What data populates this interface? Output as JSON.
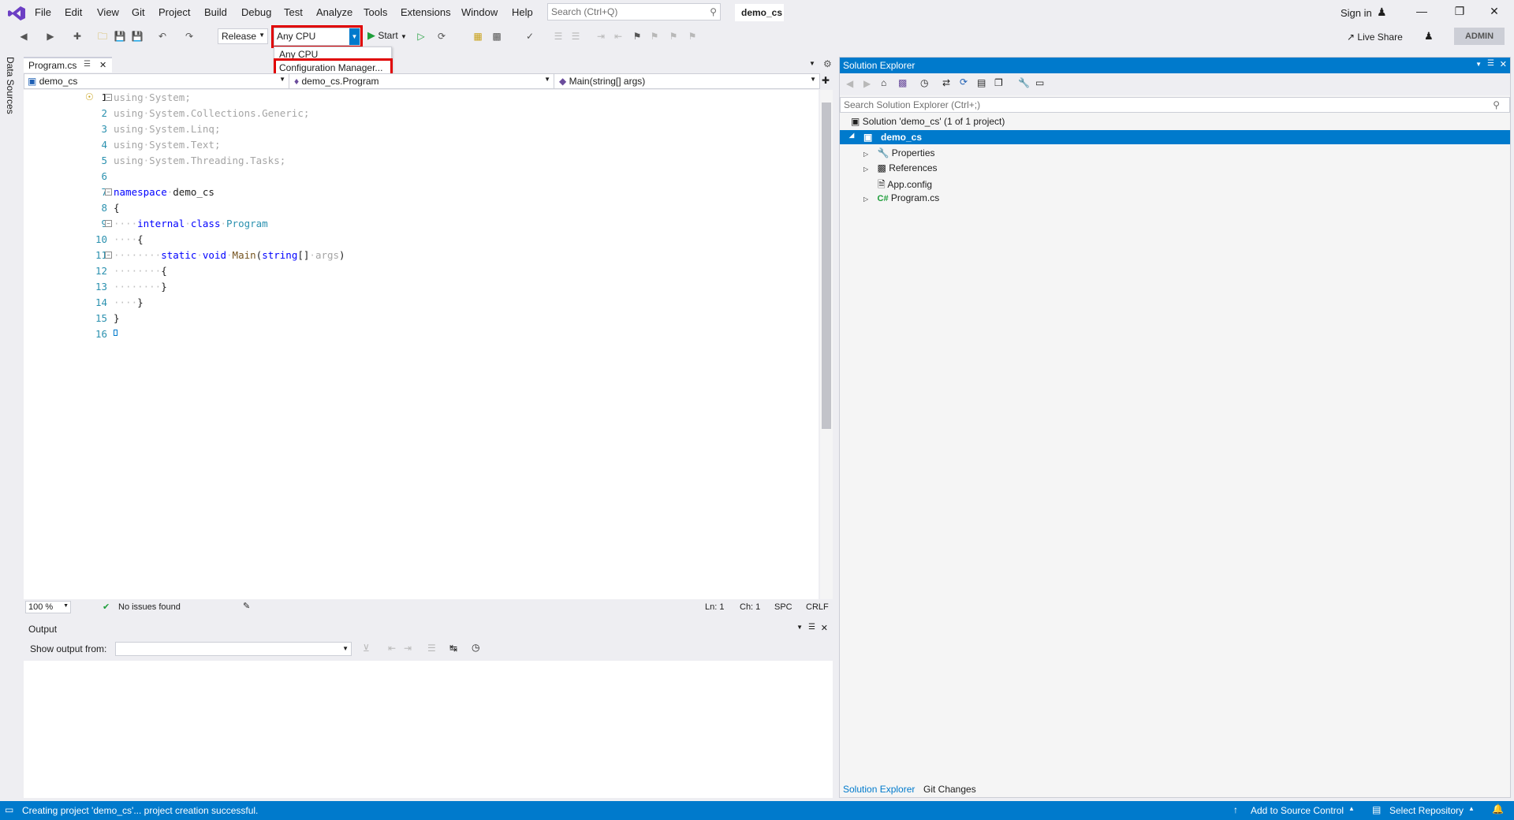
{
  "colors": {
    "accent": "#007acc",
    "highlight_border": "#e00000",
    "keyword": "#0000ff",
    "type": "#2b91af",
    "dim": "#a5a5a5",
    "success": "#1e9e3a"
  },
  "menu": {
    "items": [
      "File",
      "Edit",
      "View",
      "Git",
      "Project",
      "Build",
      "Debug",
      "Test",
      "Analyze",
      "Tools",
      "Extensions",
      "Window",
      "Help"
    ]
  },
  "search": {
    "placeholder": "Search (Ctrl+Q)"
  },
  "solution_name": "demo_cs",
  "account": {
    "signin": "Sign in",
    "live_share": "Live Share",
    "admin": "ADMIN"
  },
  "toolbar": {
    "configuration": "Release",
    "platform": "Any CPU",
    "start": "Start"
  },
  "platform_dropdown": {
    "options": [
      "Any CPU",
      "Configuration Manager..."
    ]
  },
  "side_panel": {
    "data_sources": "Data Sources"
  },
  "editor": {
    "tab": "Program.cs",
    "nav": {
      "project": "demo_cs",
      "type": "demo_cs.Program",
      "member": "Main(string[] args)"
    },
    "lines": [
      "1",
      "2",
      "3",
      "4",
      "5",
      "6",
      "7",
      "8",
      "9",
      "10",
      "11",
      "12",
      "13",
      "14",
      "15",
      "16"
    ],
    "code": {
      "l1a": "using",
      "l1b": "System;",
      "l2a": "using",
      "l2b": "System.Collections.Generic;",
      "l3a": "using",
      "l3b": "System.Linq;",
      "l4a": "using",
      "l4b": "System.Text;",
      "l5a": "using",
      "l5b": "System.Threading.Tasks;",
      "l7a": "namespace",
      "l7b": "demo_cs",
      "l8": "{",
      "l9a": "internal",
      "l9b": "class",
      "l9c": "Program",
      "l10": "{",
      "l11a": "static",
      "l11b": "void",
      "l11c": "Main",
      "l11d": "(",
      "l11e": "string",
      "l11f": "[]",
      "l11g": "args",
      "l11h": ")",
      "l12": "{",
      "l13": "}",
      "l14": "}",
      "l15": "}"
    },
    "status": {
      "zoom": "100 %",
      "issues": "No issues found",
      "ln": "Ln: 1",
      "ch": "Ch: 1",
      "spc": "SPC",
      "crlf": "CRLF"
    }
  },
  "output": {
    "title": "Output",
    "show_from": "Show output from:"
  },
  "solution_explorer": {
    "title": "Solution Explorer",
    "search_placeholder": "Search Solution Explorer (Ctrl+;)",
    "solution": "Solution 'demo_cs' (1 of 1 project)",
    "project": "demo_cs",
    "items": [
      "Properties",
      "References",
      "App.config",
      "Program.cs"
    ],
    "tabs": [
      "Solution Explorer",
      "Git Changes"
    ]
  },
  "statusbar": {
    "message": "Creating project 'demo_cs'... project creation successful.",
    "add_source": "Add to Source Control",
    "select_repo": "Select Repository"
  }
}
